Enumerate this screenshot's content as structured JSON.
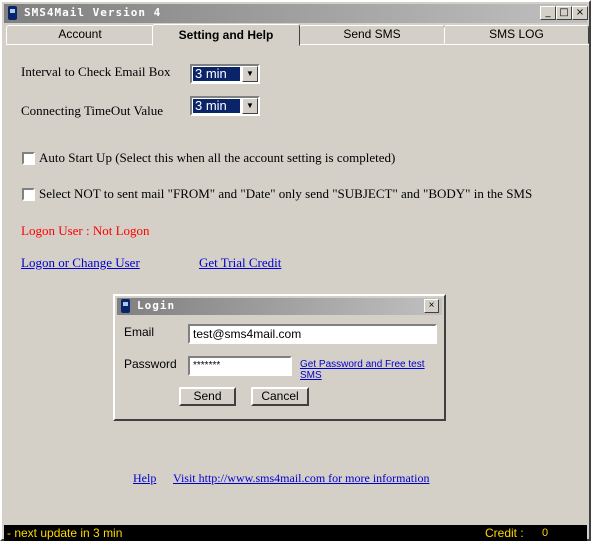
{
  "window": {
    "title": "SMS4Mail Version 4",
    "minimize": "_",
    "maximize": "□",
    "close": "×"
  },
  "tabs": [
    {
      "label": "Account"
    },
    {
      "label": "Setting and Help"
    },
    {
      "label": "Send SMS"
    },
    {
      "label": "SMS LOG"
    }
  ],
  "settings": {
    "interval_label": "Interval to Check Email Box",
    "interval_value": "3 min",
    "timeout_label": "Connecting TimeOut Value",
    "timeout_value": "3 min",
    "autostart_label": "Auto Start Up (Select this when all the account setting is completed)",
    "autostart_checked": false,
    "notsend_label": "Select NOT to sent mail \"FROM\" and \"Date\" only send \"SUBJECT\" and \"BODY\" in the SMS",
    "notsend_checked": false,
    "logon_status": "Logon User : Not Logon",
    "logon_link": "Logon or Change User",
    "trial_link": "Get Trial Credit"
  },
  "login_dialog": {
    "title": "Login",
    "close": "×",
    "email_label": "Email",
    "email_value": "test@sms4mail.com",
    "password_label": "Password",
    "password_value": "*******",
    "password_link": "Get Password and Free test SMS",
    "send_label": "Send",
    "cancel_label": "Cancel"
  },
  "footer": {
    "help_link": "Help",
    "visit_link": "Visit http://www.sms4mail.com for more information"
  },
  "status_bar": {
    "message": "- next update in 3 min",
    "credit_label": "Credit :",
    "credit_value": "0"
  },
  "colors": {
    "status_text": "#ffd800",
    "error_text": "#ff0000",
    "link": "#0000cc",
    "face": "#d4d0c8"
  }
}
